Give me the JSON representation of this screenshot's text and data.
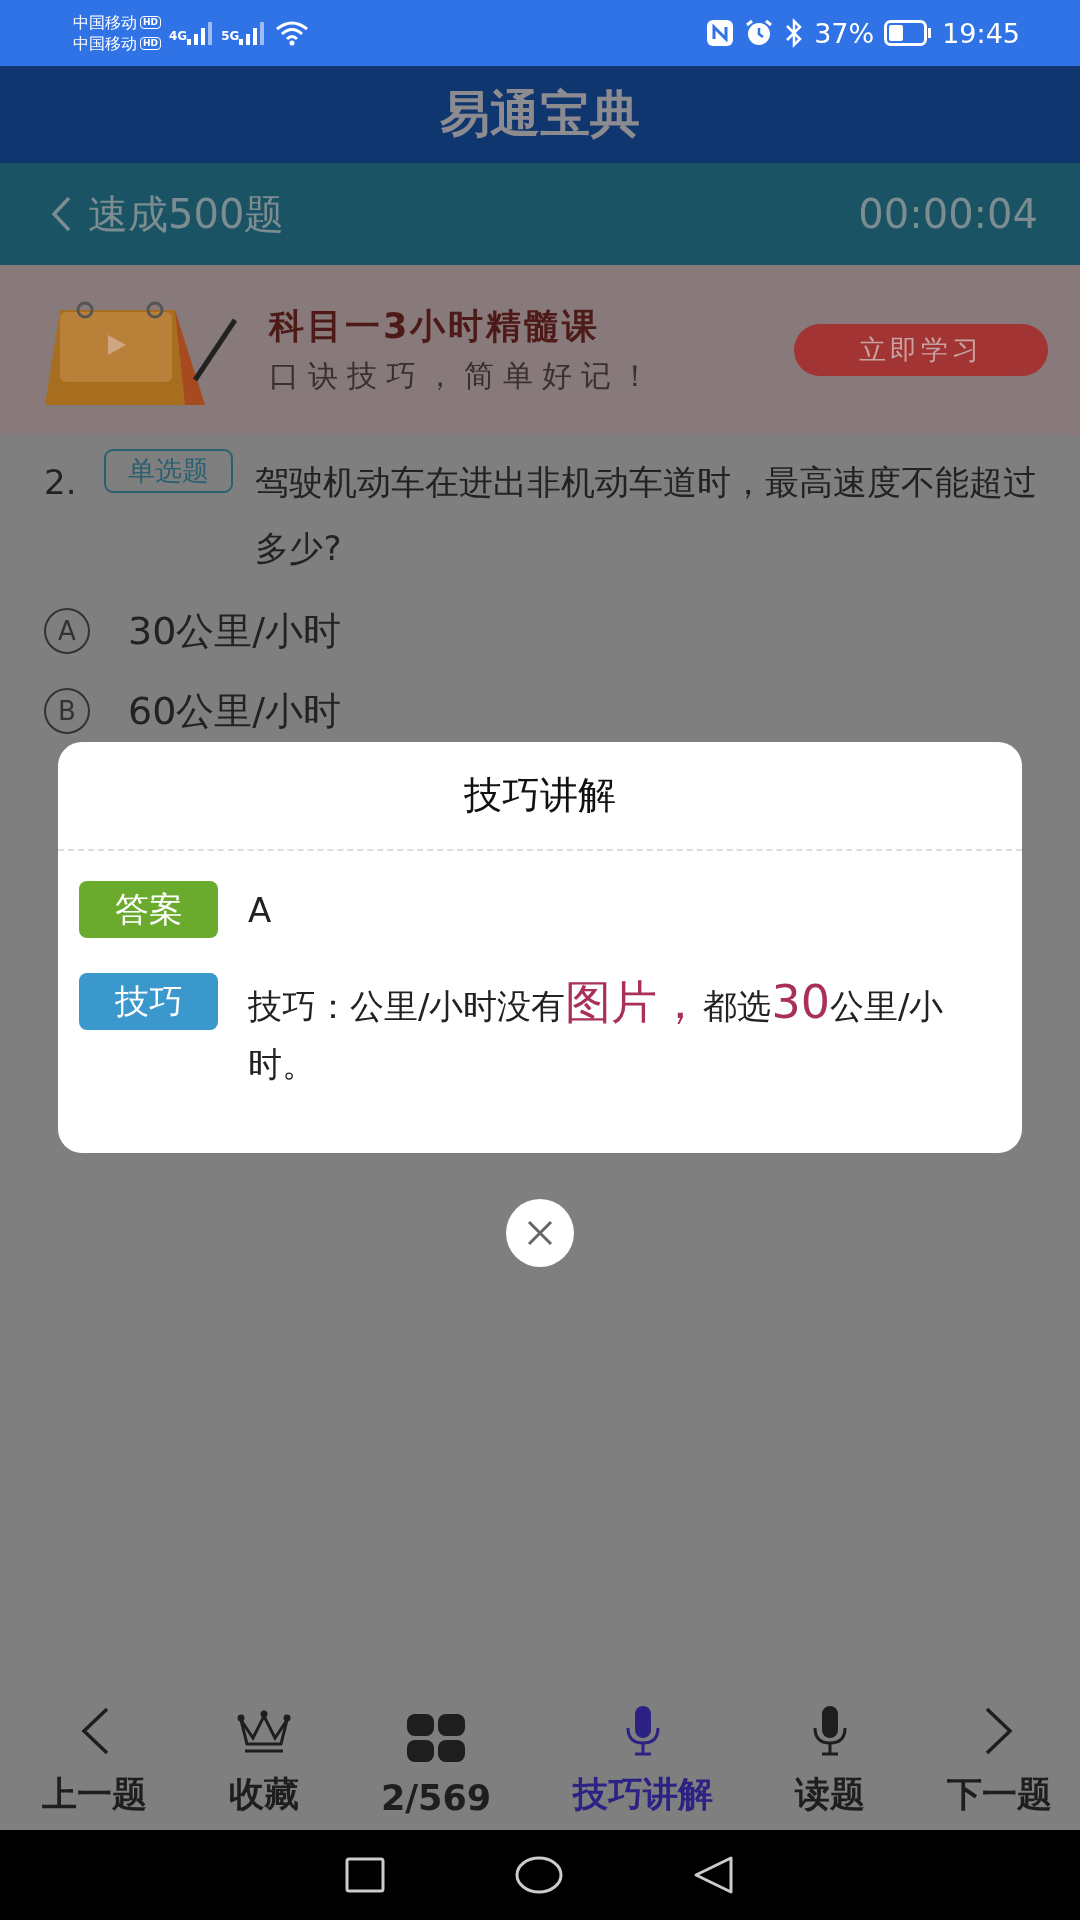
{
  "status_bar": {
    "carriers": [
      {
        "name": "中国移动",
        "badge": "HD"
      },
      {
        "name": "中国移动",
        "badge": "HD"
      }
    ],
    "networks": [
      "4G",
      "5G"
    ],
    "battery": "37%",
    "time": "19:45"
  },
  "app_bar": {
    "title": "易通宝典"
  },
  "sub_header": {
    "back_label": "速成500题",
    "timer": "00:00:04"
  },
  "banner": {
    "title": "科目一3小时精髓课",
    "subtitle": "口诀技巧，简单好记！",
    "button": "立即学习"
  },
  "question": {
    "number": "2.",
    "type_tag": "单选题",
    "text": "驾驶机动车在进出非机动车道时，最高速度不能超过多少?",
    "options": [
      {
        "letter": "A",
        "text": "30公里/小时"
      },
      {
        "letter": "B",
        "text": "60公里/小时"
      }
    ]
  },
  "dialog": {
    "title": "技巧讲解",
    "rows": [
      {
        "tag": "答案",
        "color": "#6aaa2c",
        "text": "A"
      },
      {
        "tag": "技巧",
        "color": "#3b98cc",
        "text": "技巧：公里/小时没有**图片，**都选**30**公里/小时。"
      }
    ]
  },
  "bottom_nav": [
    {
      "kind": "prev",
      "label": "上一题",
      "selected": false
    },
    {
      "kind": "crown",
      "label": "收藏",
      "selected": false
    },
    {
      "kind": "grid",
      "label": "2/569",
      "selected": false
    },
    {
      "kind": "mic",
      "label": "技巧讲解",
      "selected": true
    },
    {
      "kind": "mic",
      "label": "读题",
      "selected": false
    },
    {
      "kind": "next",
      "label": "下一题",
      "selected": false
    }
  ]
}
